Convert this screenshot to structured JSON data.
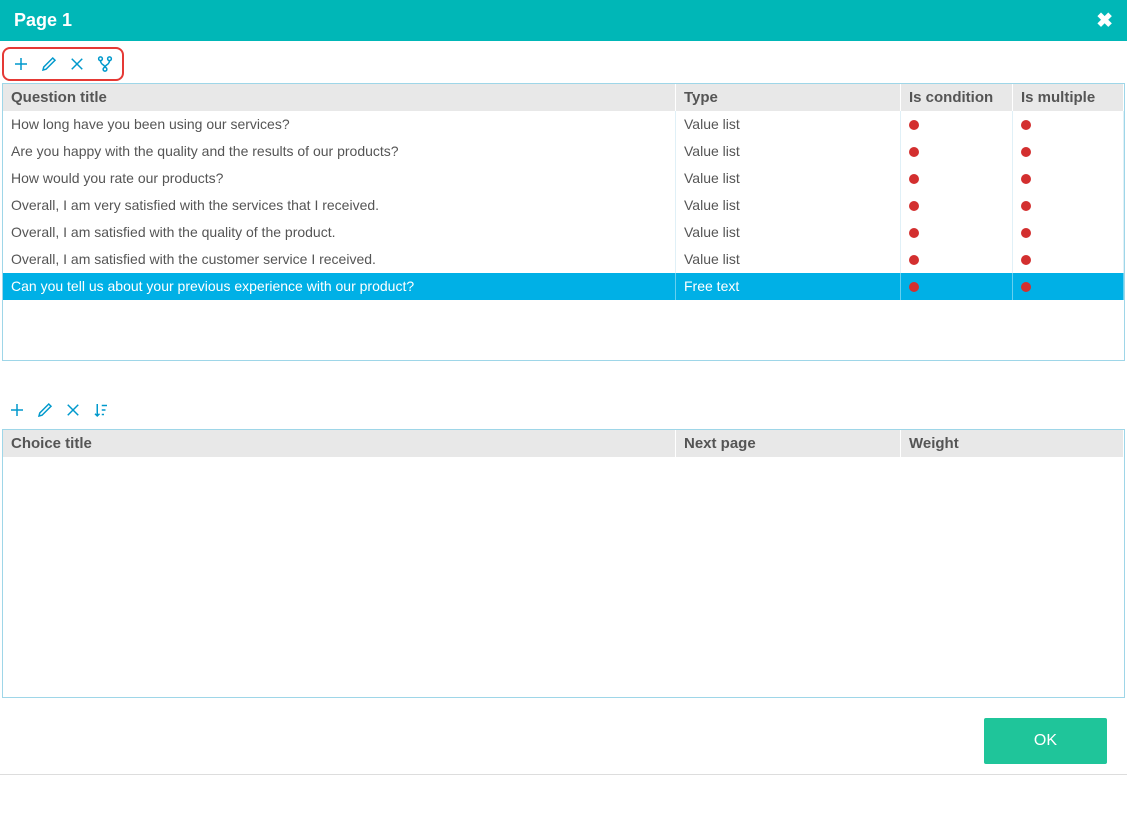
{
  "header": {
    "title": "Page 1"
  },
  "questions_grid": {
    "columns": {
      "title": "Question title",
      "type": "Type",
      "is_condition": "Is condition",
      "is_multiple": "Is multiple"
    },
    "rows": [
      {
        "title": "How long have you been using our services?",
        "type": "Value list",
        "is_condition": true,
        "is_multiple": true,
        "selected": false
      },
      {
        "title": "Are you happy with the quality and the results of our products?",
        "type": "Value list",
        "is_condition": true,
        "is_multiple": true,
        "selected": false
      },
      {
        "title": "How would you rate our products?",
        "type": "Value list",
        "is_condition": true,
        "is_multiple": true,
        "selected": false
      },
      {
        "title": "Overall, I am very satisfied with the services that I received.",
        "type": "Value list",
        "is_condition": true,
        "is_multiple": true,
        "selected": false
      },
      {
        "title": "Overall, I am satisfied with the quality of the product.",
        "type": "Value list",
        "is_condition": true,
        "is_multiple": true,
        "selected": false
      },
      {
        "title": "Overall, I am satisfied with the customer service I received.",
        "type": "Value list",
        "is_condition": true,
        "is_multiple": true,
        "selected": false
      },
      {
        "title": "Can you tell us about your previous experience with our product?",
        "type": "Free text",
        "is_condition": true,
        "is_multiple": true,
        "selected": true
      }
    ]
  },
  "choices_grid": {
    "columns": {
      "title": "Choice title",
      "next_page": "Next page",
      "weight": "Weight"
    },
    "rows": []
  },
  "buttons": {
    "ok": "OK"
  }
}
